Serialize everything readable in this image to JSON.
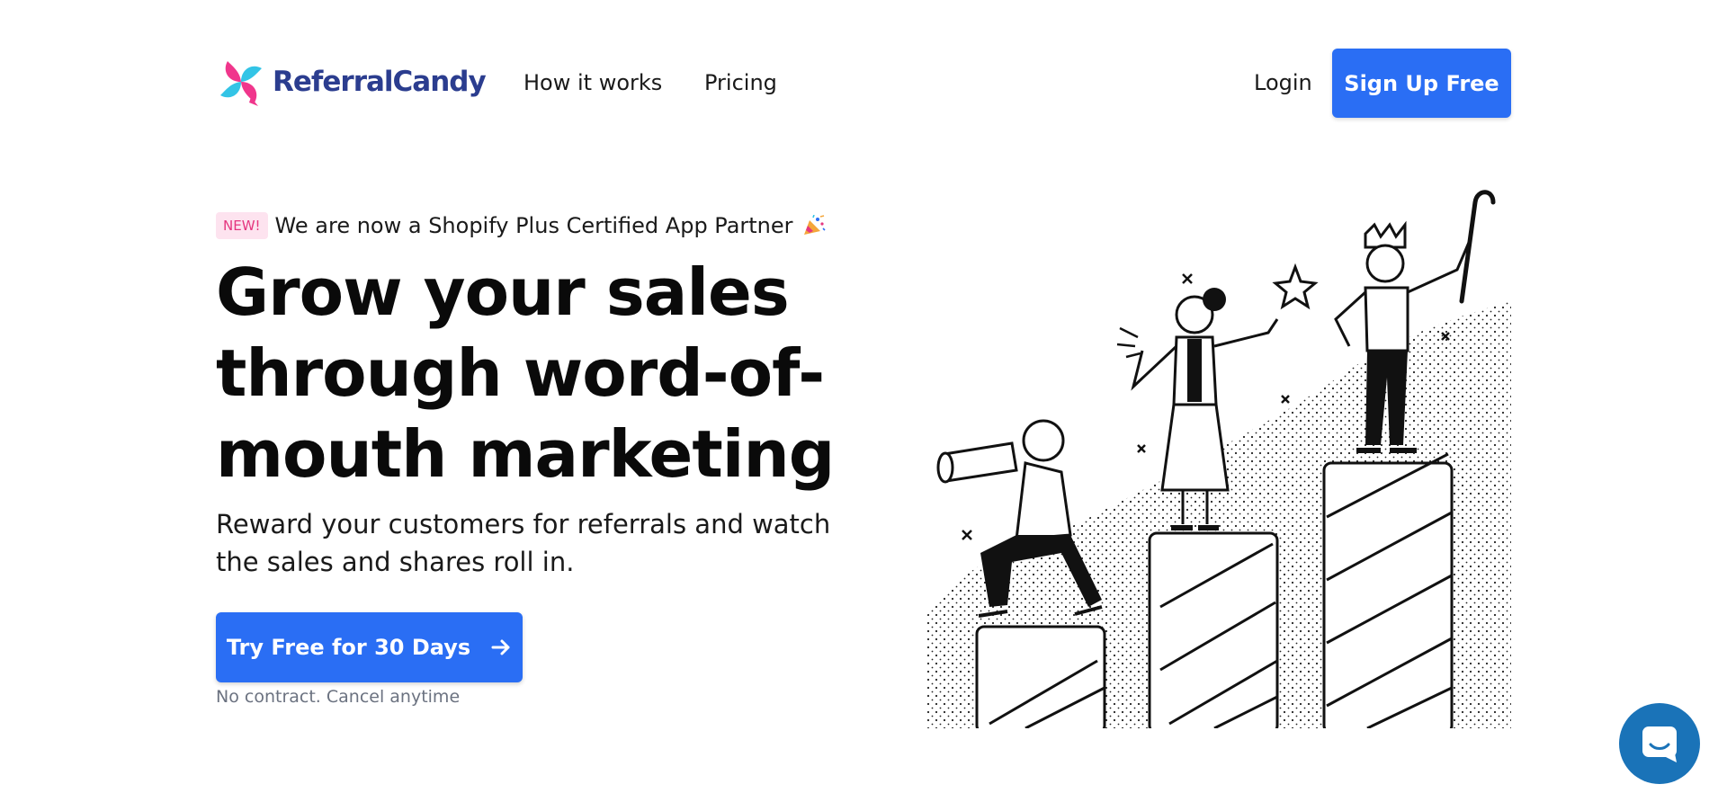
{
  "brand": {
    "name": "ReferralCandy",
    "primary_color": "#2a6ef4",
    "logo_pink": "#f0368c",
    "logo_cyan": "#33c4e6",
    "logo_text_color": "#2b3d8f"
  },
  "nav": {
    "links": [
      {
        "label": "How it works"
      },
      {
        "label": "Pricing"
      }
    ],
    "login_label": "Login",
    "signup_label": "Sign Up Free"
  },
  "announcement": {
    "badge": "NEW!",
    "text": "We are now a Shopify Plus Certified App Partner",
    "icon": "party-popper-icon"
  },
  "hero": {
    "headline": "Grow your sales through word-of-mouth marketing",
    "subheadline": "Reward your customers for referrals and watch the sales and shares roll in.",
    "cta_label": "Try Free for 30 Days",
    "cta_icon": "arrow-right-icon",
    "note": "No contract. Cancel anytime"
  },
  "illustration": {
    "icon": "people-on-podiums-illustration"
  },
  "chat": {
    "icon": "chat-bubble-icon",
    "color": "#1a73b8"
  }
}
